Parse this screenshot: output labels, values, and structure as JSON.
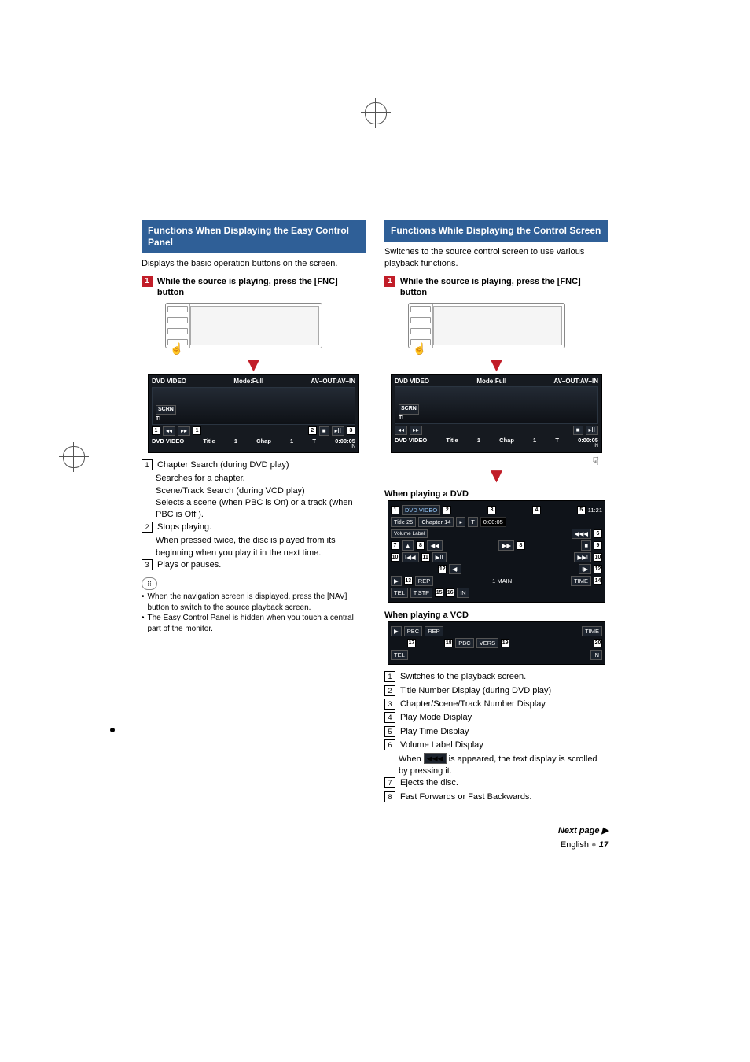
{
  "left": {
    "title": "Functions When Displaying the Easy Control Panel",
    "intro": "Displays the basic operation buttons on the screen.",
    "step_num": "1",
    "step_text": "While the source is playing, press the [FNC] button",
    "ui": {
      "top_left": "DVD VIDEO",
      "top_mid": "Mode:Full",
      "top_right": "AV–OUT:AV–IN",
      "scrn": "SCRN",
      "ti": "TI",
      "c1": "1",
      "c2": "2",
      "c3": "3",
      "prev": "◂◂",
      "next": "▸▸",
      "stop": "■",
      "play": "▸II",
      "bottom_src": "DVD VIDEO",
      "bottom_title": "Title",
      "bottom_title_n": "1",
      "bottom_chap": "Chap",
      "bottom_chap_n": "1",
      "bottom_t": "T",
      "bottom_time": "0:00:05",
      "in": "IN"
    },
    "items": [
      {
        "n": "1",
        "head": "Chapter Search (during DVD play)",
        "lines": [
          "Searches for a chapter.",
          "Scene/Track Search (during VCD play)",
          "Selects a scene (when PBC is On) or a track (when PBC is Off )."
        ]
      },
      {
        "n": "2",
        "head": "Stops playing.",
        "lines": [
          "When pressed twice, the disc is played from its beginning when you play it in the next time."
        ]
      },
      {
        "n": "3",
        "head": "Plays or pauses.",
        "lines": []
      }
    ],
    "notes": [
      "When the navigation screen is displayed, press the [NAV] button to switch to the source playback screen.",
      "The Easy Control Panel is hidden when you touch a central part of the monitor."
    ]
  },
  "right": {
    "title": "Functions While Displaying the Control Screen",
    "intro": "Switches to the source control screen to use various playback functions.",
    "step_num": "1",
    "step_text": "While the source is playing, press the [FNC] button",
    "ui": {
      "top_left": "DVD VIDEO",
      "top_mid": "Mode:Full",
      "top_right": "AV–OUT:AV–IN",
      "scrn": "SCRN",
      "ti": "TI",
      "prev": "◂◂",
      "next": "▸▸",
      "stop": "■",
      "play": "▸II",
      "bottom_src": "DVD VIDEO",
      "bottom_title": "Title",
      "bottom_title_n": "1",
      "bottom_chap": "Chap",
      "bottom_chap_n": "1",
      "bottom_t": "T",
      "bottom_time": "0:00:05",
      "in": "IN"
    },
    "dvd_heading": "When playing a DVD",
    "dvd_ui": {
      "src": "DVD VIDEO",
      "clock": "11:21",
      "title_lbl": "Title",
      "title_n": "25",
      "chap_lbl": "Chapter 14",
      "play": "▸",
      "t": "T",
      "time": "0:00:05",
      "vol": "Volume Label",
      "scroll": "◀◀◀",
      "eject": "▲",
      "rew": "◀◀",
      "ff": "▶▶",
      "stop": "■",
      "prev": "I◀◀",
      "playpause": "▶II",
      "next": "▶▶I",
      "sl_back": "◀I",
      "sl_fwd": "I▶",
      "rep": "REP",
      "tstp": "T.STP",
      "main": "1 MAIN",
      "time_btn": "TIME",
      "p": "▶",
      "tel": "TEL",
      "c": {
        "1": "1",
        "2": "2",
        "3": "3",
        "4": "4",
        "5": "5",
        "6": "6",
        "7": "7",
        "8": "8",
        "9": "9",
        "10": "10",
        "11": "11",
        "12": "12",
        "13": "13",
        "14": "14",
        "15": "15",
        "16": "16"
      }
    },
    "vcd_heading": "When playing a VCD",
    "vcd_ui": {
      "p": "▶",
      "pbc": "PBC",
      "rep": "REP",
      "time_btn": "TIME",
      "tel": "TEL",
      "pbcb": "PBC",
      "vers": "VERS",
      "in": "IN",
      "c17": "17",
      "c18": "18",
      "c19": "19",
      "c20": "20"
    },
    "items": [
      {
        "n": "1",
        "text": "Switches to the playback screen."
      },
      {
        "n": "2",
        "text": "Title Number Display (during DVD play)"
      },
      {
        "n": "3",
        "text": "Chapter/Scene/Track Number Display"
      },
      {
        "n": "4",
        "text": "Play Mode Display"
      },
      {
        "n": "5",
        "text": "Play Time Display"
      },
      {
        "n": "6",
        "text": "Volume Label Display"
      },
      {
        "n": "7",
        "text": "Ejects the disc."
      },
      {
        "n": "8",
        "text": "Fast Forwards or Fast Backwards."
      }
    ],
    "item6_sub_a": "When ",
    "item6_sub_b": " is appeared, the text display is scrolled by pressing it.",
    "scroll_glyph": "◀◀◀"
  },
  "footer": {
    "next": "Next page ▶",
    "lang": "English",
    "page": "17"
  }
}
